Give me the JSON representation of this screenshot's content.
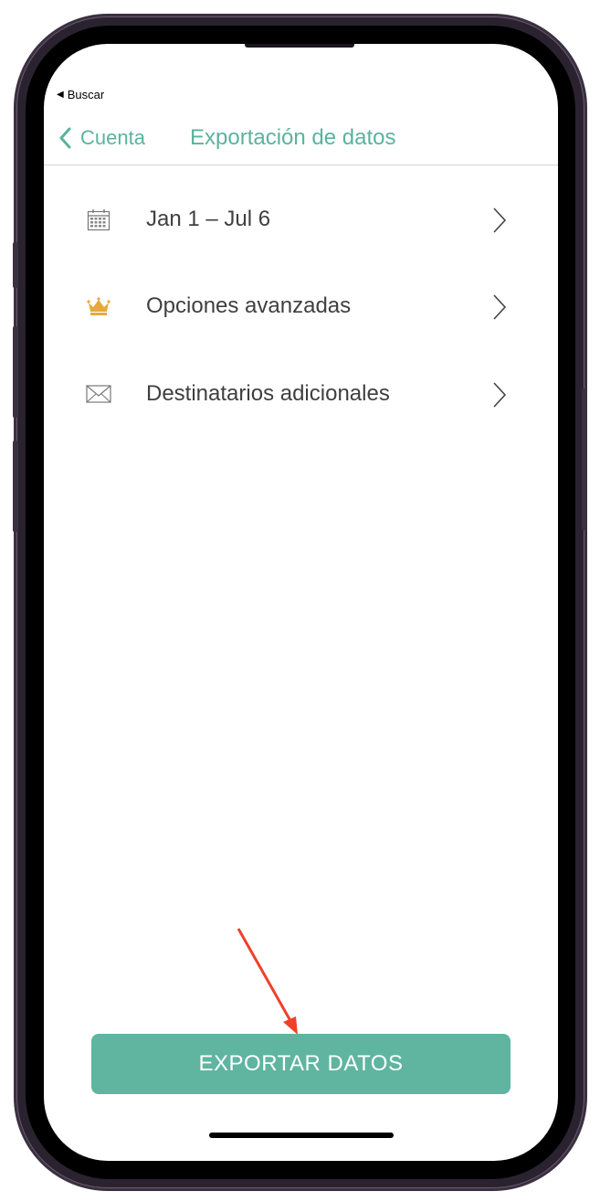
{
  "status": {
    "back_app_label": "Buscar"
  },
  "nav": {
    "back_label": "Cuenta",
    "title": "Exportación de datos"
  },
  "rows": [
    {
      "label": "Jan 1 – Jul 6",
      "icon": "calendar-icon"
    },
    {
      "label": "Opciones avanzadas",
      "icon": "crown-icon"
    },
    {
      "label": "Destinatarios adicionales",
      "icon": "envelope-icon"
    }
  ],
  "export_button": {
    "label": "EXPORTAR DATOS"
  },
  "colors": {
    "accent": "#5bb39d",
    "button": "#5fb5a0",
    "crown": "#e8a93a",
    "annotation_arrow": "#f0402a"
  }
}
